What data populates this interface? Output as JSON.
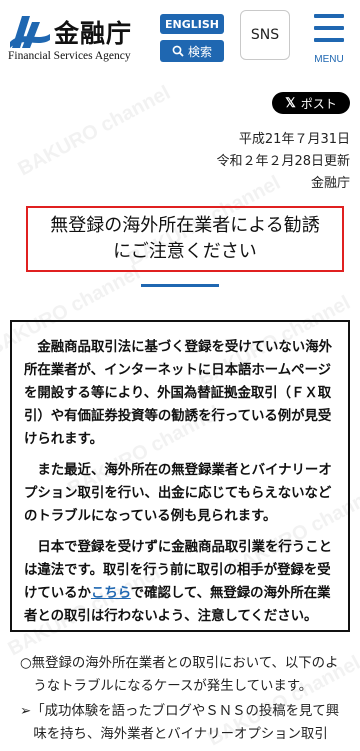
{
  "header": {
    "logo_jp": "金融庁",
    "logo_en": "Financial Services Agency",
    "english_label": "ENGLISH",
    "search_label": "検索",
    "sns_label": "SNS",
    "menu_label": "MENU"
  },
  "watermark_text": "BAKURO channel",
  "post_label": "ポスト",
  "meta": {
    "date_published": "平成21年７月31日",
    "date_updated": "令和２年２月28日更新",
    "agency": "金融庁"
  },
  "title": {
    "line1": "無登録の海外所在業者による勧誘",
    "line2": "にご注意ください"
  },
  "notice": {
    "p1": "金融商品取引法に基づく登録を受けていない海外所在業者が、インターネットに日本語ホームページを開設する等により、外国為替証拠金取引（ＦＸ取引）や有価証券投資等の勧誘を行っている例が見受けられます。",
    "p2": "また最近、海外所在の無登録業者とバイナリーオプション取引を行い、出金に応じてもらえないなどのトラブルになっている例も見られます。",
    "p3_before": "日本で登録を受けずに金融商品取引業を行うことは違法です。取引を行う前に取引の相手が登録を受けているか",
    "p3_link": "こちら",
    "p3_after": "で確認して、無登録の海外所在業者との取引は行わないよう、注意してください。"
  },
  "bottom": {
    "b1": "○無登録の海外所在業者との取引において、以下のようなトラブルになるケースが発生しています。",
    "b2": "➢「成功体験を語ったブログやＳＮＳの投稿を見て興味を持ち、海外業者とバイナリーオプション取引"
  },
  "colors": {
    "brand_blue": "#1f67b1",
    "title_border": "#e02020"
  }
}
